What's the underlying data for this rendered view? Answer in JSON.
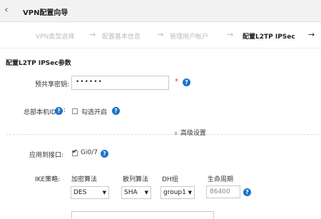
{
  "window": {
    "back_icon": "‹",
    "title": "VPN配置向导"
  },
  "steps": [
    {
      "label": "VPN类型选择"
    },
    {
      "label": "配置基本信息"
    },
    {
      "label": "管理用户帐户"
    },
    {
      "label": "配置L2TP IPSec"
    }
  ],
  "form": {
    "section_title": "配置L2TP IPSec参数",
    "psk_label": "预共享密钥:",
    "psk_value": "••••••",
    "required_mark": "*",
    "hq_id_label": "总部本机ID",
    "hq_id_colon": ":",
    "hq_checkbox_label": "勾选开启",
    "advanced_label": "高级设置",
    "advanced_icon": "»",
    "apply_iface_label": "应用到接口:",
    "iface_value": "Gi0/7",
    "ike_label": "IKE策略:",
    "ike_columns": [
      "加密算法",
      "散列算法",
      "DH组",
      "生命周期"
    ],
    "encryption": "DES",
    "hash": "SHA",
    "dh_group": "group1",
    "lifetime": "86400"
  },
  "help_glyph": "?",
  "colors": {
    "accent": "#1a73c8",
    "warning": "#e87722",
    "required": "#ee3333"
  }
}
